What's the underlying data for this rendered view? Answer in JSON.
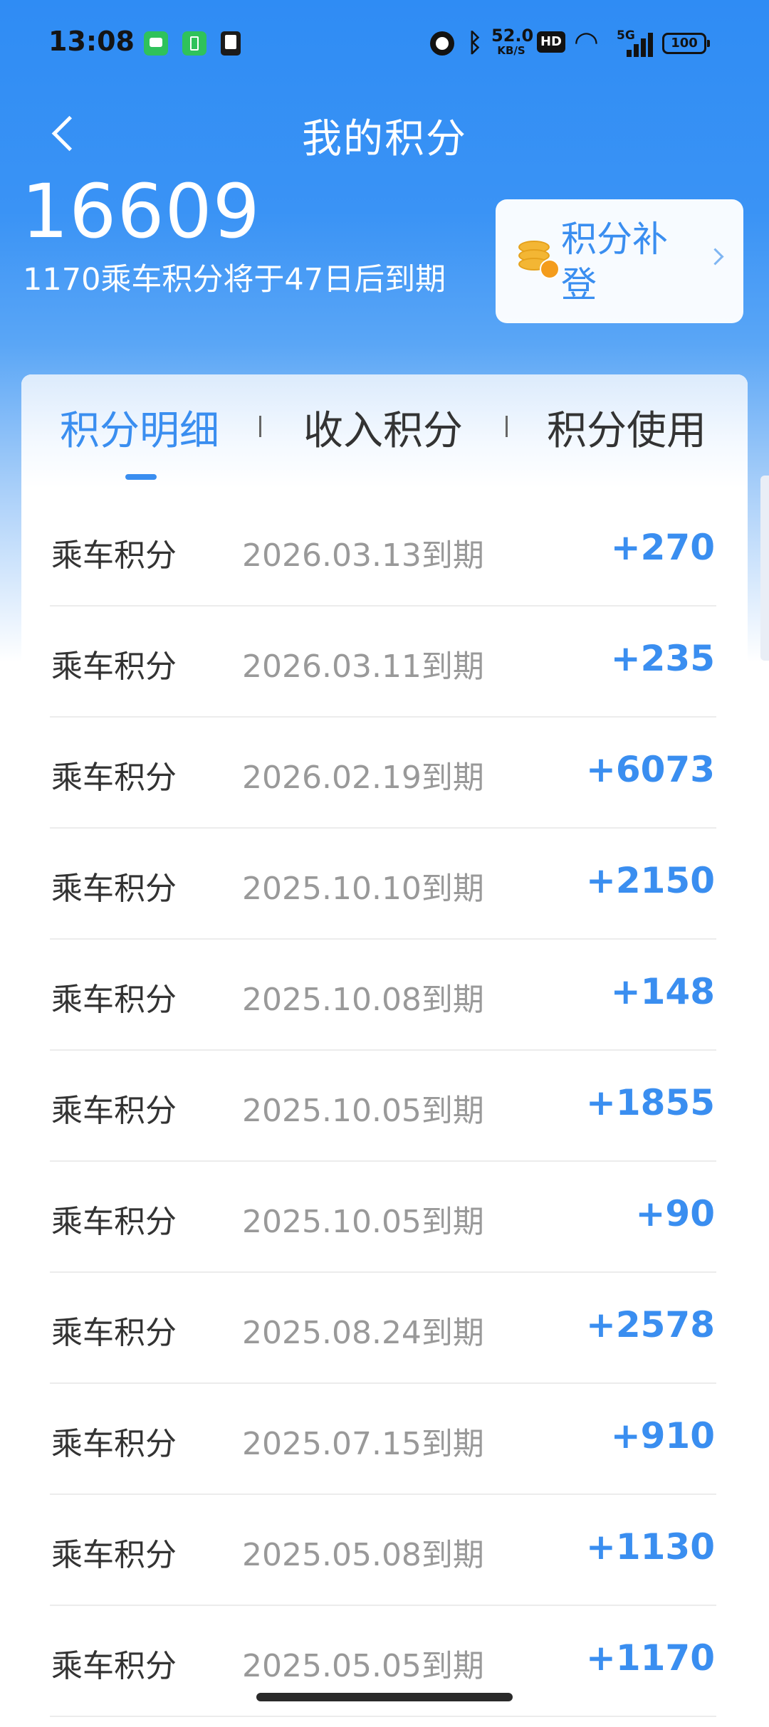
{
  "status_bar": {
    "time": "13:08",
    "net_speed_value": "52.0",
    "net_speed_unit": "KB/S",
    "hd_label": "HD",
    "signal_label": "5G",
    "battery": "100"
  },
  "header": {
    "title": "我的积分",
    "back_icon": "chevron-left-icon"
  },
  "summary": {
    "total_points": "16609",
    "expiry_note": "1170乘车积分将于47日后到期"
  },
  "supplement": {
    "label": "积分补登",
    "icon": "coin-stack-icon"
  },
  "tabs": [
    {
      "label": "积分明细",
      "active": true
    },
    {
      "label": "收入积分",
      "active": false
    },
    {
      "label": "积分使用",
      "active": false
    }
  ],
  "records": [
    {
      "type": "乘车积分",
      "expiry": "2026.03.13到期",
      "points": "+270"
    },
    {
      "type": "乘车积分",
      "expiry": "2026.03.11到期",
      "points": "+235"
    },
    {
      "type": "乘车积分",
      "expiry": "2026.02.19到期",
      "points": "+6073"
    },
    {
      "type": "乘车积分",
      "expiry": "2025.10.10到期",
      "points": "+2150"
    },
    {
      "type": "乘车积分",
      "expiry": "2025.10.08到期",
      "points": "+148"
    },
    {
      "type": "乘车积分",
      "expiry": "2025.10.05到期",
      "points": "+1855"
    },
    {
      "type": "乘车积分",
      "expiry": "2025.10.05到期",
      "points": "+90"
    },
    {
      "type": "乘车积分",
      "expiry": "2025.08.24到期",
      "points": "+2578"
    },
    {
      "type": "乘车积分",
      "expiry": "2025.07.15到期",
      "points": "+910"
    },
    {
      "type": "乘车积分",
      "expiry": "2025.05.08到期",
      "points": "+1130"
    },
    {
      "type": "乘车积分",
      "expiry": "2025.05.05到期",
      "points": "+1170"
    }
  ],
  "colors": {
    "accent": "#3a8ef0",
    "header_bg": "#2f8cf4"
  }
}
